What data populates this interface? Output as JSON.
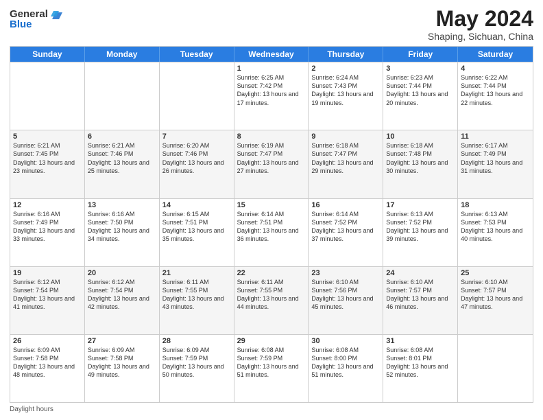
{
  "header": {
    "logo_general": "General",
    "logo_blue": "Blue",
    "month_title": "May 2024",
    "location": "Shaping, Sichuan, China"
  },
  "weekdays": [
    "Sunday",
    "Monday",
    "Tuesday",
    "Wednesday",
    "Thursday",
    "Friday",
    "Saturday"
  ],
  "footer": {
    "daylight_label": "Daylight hours"
  },
  "rows": [
    {
      "alt": false,
      "cells": [
        {
          "day": "",
          "text": ""
        },
        {
          "day": "",
          "text": ""
        },
        {
          "day": "",
          "text": ""
        },
        {
          "day": "1",
          "text": "Sunrise: 6:25 AM\nSunset: 7:42 PM\nDaylight: 13 hours and 17 minutes."
        },
        {
          "day": "2",
          "text": "Sunrise: 6:24 AM\nSunset: 7:43 PM\nDaylight: 13 hours and 19 minutes."
        },
        {
          "day": "3",
          "text": "Sunrise: 6:23 AM\nSunset: 7:44 PM\nDaylight: 13 hours and 20 minutes."
        },
        {
          "day": "4",
          "text": "Sunrise: 6:22 AM\nSunset: 7:44 PM\nDaylight: 13 hours and 22 minutes."
        }
      ]
    },
    {
      "alt": true,
      "cells": [
        {
          "day": "5",
          "text": "Sunrise: 6:21 AM\nSunset: 7:45 PM\nDaylight: 13 hours and 23 minutes."
        },
        {
          "day": "6",
          "text": "Sunrise: 6:21 AM\nSunset: 7:46 PM\nDaylight: 13 hours and 25 minutes."
        },
        {
          "day": "7",
          "text": "Sunrise: 6:20 AM\nSunset: 7:46 PM\nDaylight: 13 hours and 26 minutes."
        },
        {
          "day": "8",
          "text": "Sunrise: 6:19 AM\nSunset: 7:47 PM\nDaylight: 13 hours and 27 minutes."
        },
        {
          "day": "9",
          "text": "Sunrise: 6:18 AM\nSunset: 7:47 PM\nDaylight: 13 hours and 29 minutes."
        },
        {
          "day": "10",
          "text": "Sunrise: 6:18 AM\nSunset: 7:48 PM\nDaylight: 13 hours and 30 minutes."
        },
        {
          "day": "11",
          "text": "Sunrise: 6:17 AM\nSunset: 7:49 PM\nDaylight: 13 hours and 31 minutes."
        }
      ]
    },
    {
      "alt": false,
      "cells": [
        {
          "day": "12",
          "text": "Sunrise: 6:16 AM\nSunset: 7:49 PM\nDaylight: 13 hours and 33 minutes."
        },
        {
          "day": "13",
          "text": "Sunrise: 6:16 AM\nSunset: 7:50 PM\nDaylight: 13 hours and 34 minutes."
        },
        {
          "day": "14",
          "text": "Sunrise: 6:15 AM\nSunset: 7:51 PM\nDaylight: 13 hours and 35 minutes."
        },
        {
          "day": "15",
          "text": "Sunrise: 6:14 AM\nSunset: 7:51 PM\nDaylight: 13 hours and 36 minutes."
        },
        {
          "day": "16",
          "text": "Sunrise: 6:14 AM\nSunset: 7:52 PM\nDaylight: 13 hours and 37 minutes."
        },
        {
          "day": "17",
          "text": "Sunrise: 6:13 AM\nSunset: 7:52 PM\nDaylight: 13 hours and 39 minutes."
        },
        {
          "day": "18",
          "text": "Sunrise: 6:13 AM\nSunset: 7:53 PM\nDaylight: 13 hours and 40 minutes."
        }
      ]
    },
    {
      "alt": true,
      "cells": [
        {
          "day": "19",
          "text": "Sunrise: 6:12 AM\nSunset: 7:54 PM\nDaylight: 13 hours and 41 minutes."
        },
        {
          "day": "20",
          "text": "Sunrise: 6:12 AM\nSunset: 7:54 PM\nDaylight: 13 hours and 42 minutes."
        },
        {
          "day": "21",
          "text": "Sunrise: 6:11 AM\nSunset: 7:55 PM\nDaylight: 13 hours and 43 minutes."
        },
        {
          "day": "22",
          "text": "Sunrise: 6:11 AM\nSunset: 7:55 PM\nDaylight: 13 hours and 44 minutes."
        },
        {
          "day": "23",
          "text": "Sunrise: 6:10 AM\nSunset: 7:56 PM\nDaylight: 13 hours and 45 minutes."
        },
        {
          "day": "24",
          "text": "Sunrise: 6:10 AM\nSunset: 7:57 PM\nDaylight: 13 hours and 46 minutes."
        },
        {
          "day": "25",
          "text": "Sunrise: 6:10 AM\nSunset: 7:57 PM\nDaylight: 13 hours and 47 minutes."
        }
      ]
    },
    {
      "alt": false,
      "cells": [
        {
          "day": "26",
          "text": "Sunrise: 6:09 AM\nSunset: 7:58 PM\nDaylight: 13 hours and 48 minutes."
        },
        {
          "day": "27",
          "text": "Sunrise: 6:09 AM\nSunset: 7:58 PM\nDaylight: 13 hours and 49 minutes."
        },
        {
          "day": "28",
          "text": "Sunrise: 6:09 AM\nSunset: 7:59 PM\nDaylight: 13 hours and 50 minutes."
        },
        {
          "day": "29",
          "text": "Sunrise: 6:08 AM\nSunset: 7:59 PM\nDaylight: 13 hours and 51 minutes."
        },
        {
          "day": "30",
          "text": "Sunrise: 6:08 AM\nSunset: 8:00 PM\nDaylight: 13 hours and 51 minutes."
        },
        {
          "day": "31",
          "text": "Sunrise: 6:08 AM\nSunset: 8:01 PM\nDaylight: 13 hours and 52 minutes."
        },
        {
          "day": "",
          "text": ""
        }
      ]
    }
  ]
}
